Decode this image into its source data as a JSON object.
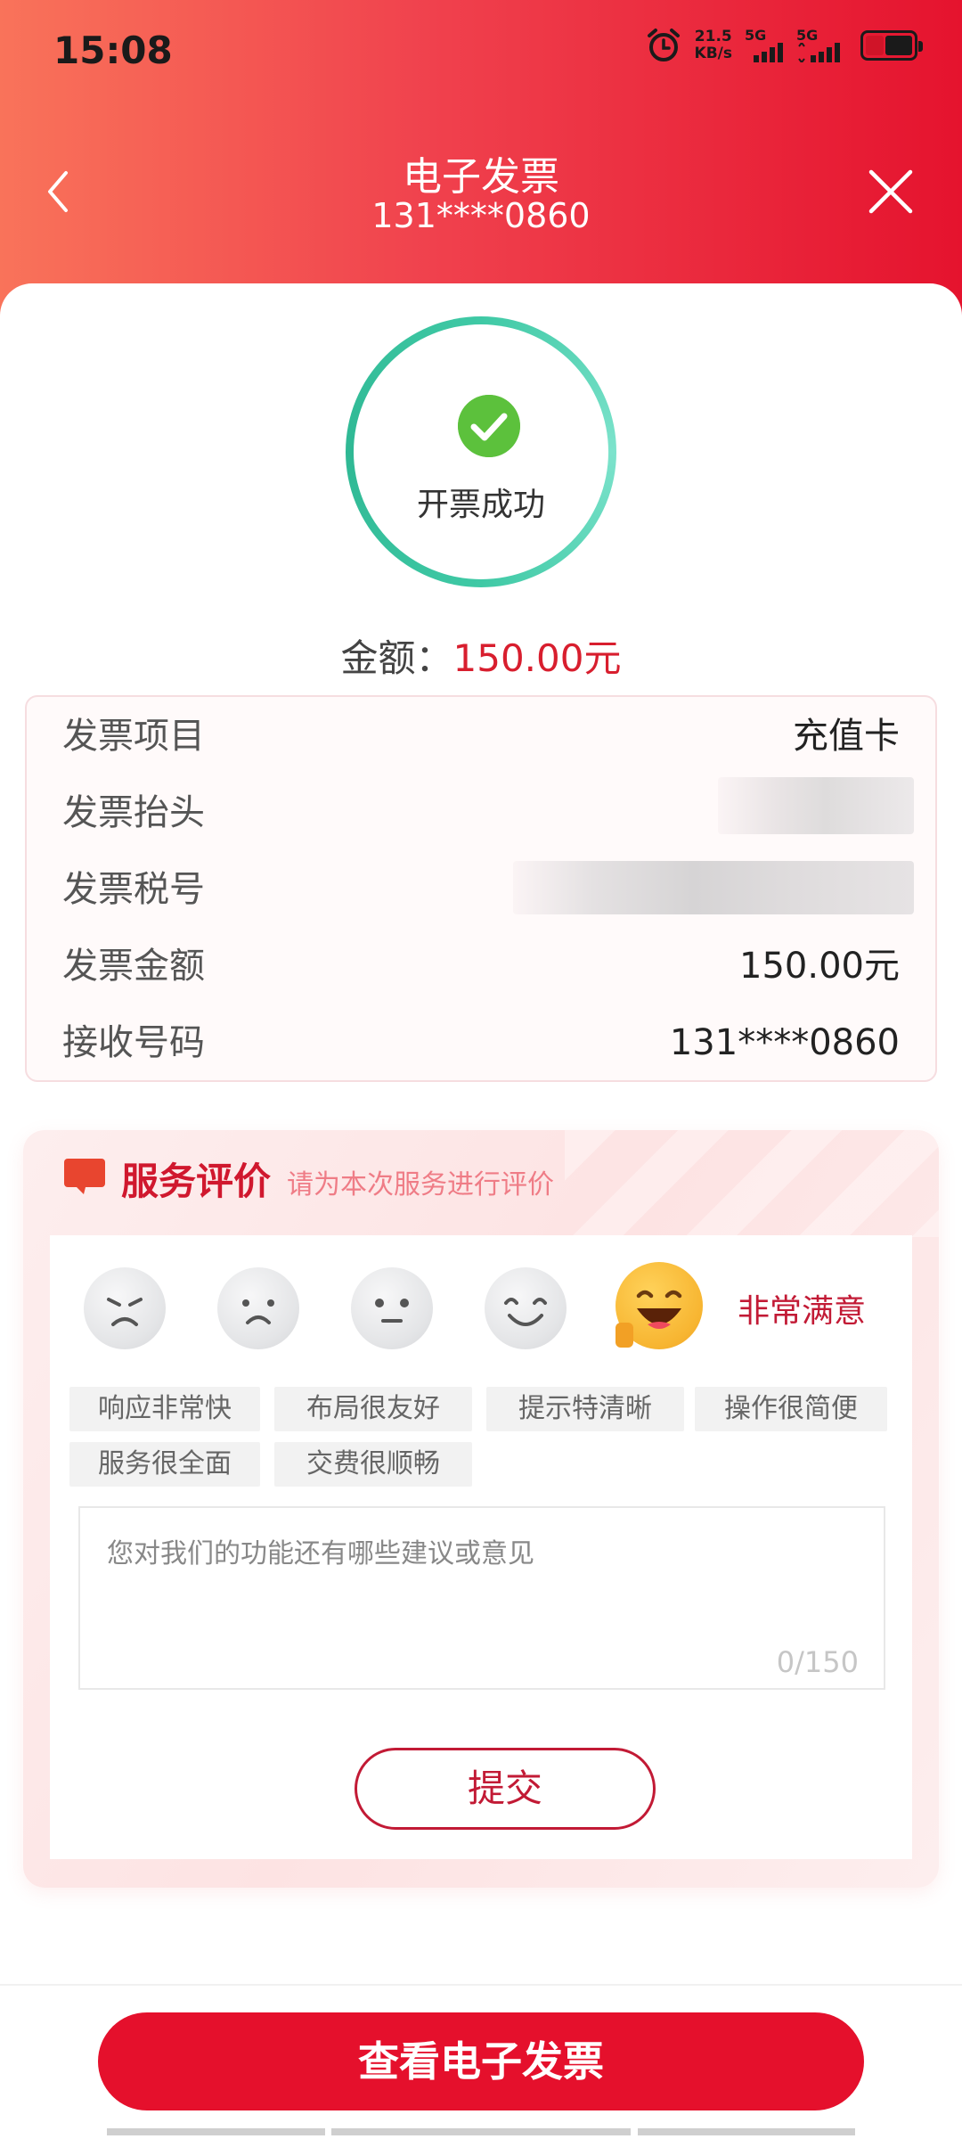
{
  "status_bar": {
    "time": "15:08",
    "net_speed_value": "21.5",
    "net_speed_unit": "KB/s",
    "sim1": "5G",
    "sim2": "5G",
    "battery_icon": "battery-low-icon"
  },
  "nav": {
    "title": "电子发票",
    "subtitle": "131****0860",
    "back_icon": "chevron-left-icon",
    "close_icon": "close-icon"
  },
  "result": {
    "status_text": "开票成功",
    "amount_label": "金额：",
    "amount_value": "150.00元",
    "status_color": "#3fc9a5",
    "amount_color": "#d81e2e"
  },
  "invoice": {
    "rows": [
      {
        "label": "发票项目",
        "value": "充值卡"
      },
      {
        "label": "发票抬头",
        "value": ""
      },
      {
        "label": "发票税号",
        "value": ""
      },
      {
        "label": "发票金额",
        "value": "150.00元"
      },
      {
        "label": "接收号码",
        "value": "131****0860"
      }
    ]
  },
  "service": {
    "title": "服务评价",
    "subtitle": "请为本次服务进行评价",
    "selected_rating_label": "非常满意",
    "ratings": [
      "angry",
      "sad",
      "neutral",
      "smile",
      "very-happy"
    ],
    "tags": [
      "响应非常快",
      "布局很友好",
      "提示特清晰",
      "操作很简便",
      "服务很全面",
      "交费很顺畅"
    ],
    "feedback_placeholder": "您对我们的功能还有哪些建议或意见",
    "feedback_count": "0/150",
    "submit_label": "提交",
    "accent_color": "#c21a35"
  },
  "footer": {
    "view_button_label": "查看电子发票",
    "button_color": "#e5102c"
  }
}
